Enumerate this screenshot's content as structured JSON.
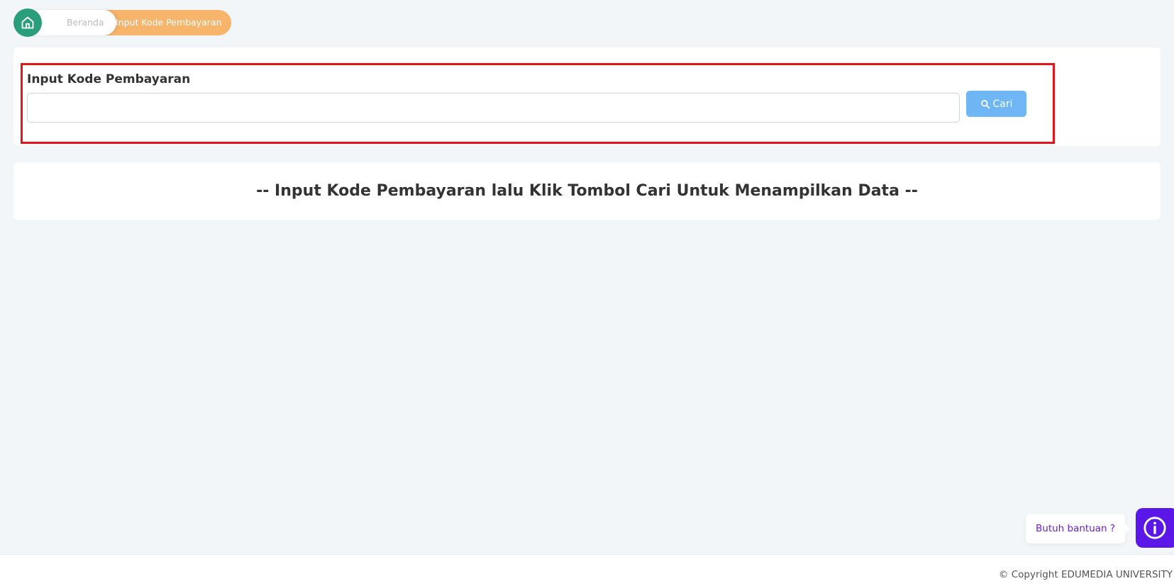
{
  "breadcrumb": {
    "home_icon": "home-icon",
    "beranda_label": "Beranda",
    "current_label": "Input Kode Pembayaran"
  },
  "form": {
    "label": "Input Kode Pembayaran",
    "input_value": "",
    "input_placeholder": "",
    "search_icon": "search-icon",
    "search_button_label": "Cari"
  },
  "message": {
    "text": "-- Input Kode Pembayaran lalu Klik Tombol Cari Untuk Menampilkan Data --"
  },
  "help": {
    "label": "Butuh bantuan ?",
    "icon": "info-icon"
  },
  "footer": {
    "copyright": "© Copyright EDUMEDIA UNIVERSITY"
  },
  "colors": {
    "background": "#f3f6f9",
    "home_green": "#2a9d7a",
    "breadcrumb_orange": "#f7b46b",
    "button_blue": "#6fb6f5",
    "highlight_red": "#e3141a",
    "help_purple": "#5b16e8"
  }
}
